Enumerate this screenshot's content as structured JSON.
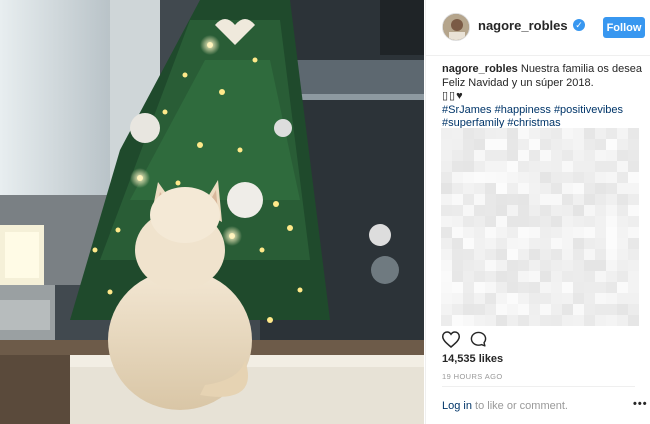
{
  "post": {
    "username": "nagore_robles",
    "follow_label": "Follow",
    "caption_line1": "Nuestra familia os desea",
    "caption_line2": "Feliz Navidad y un súper 2018.",
    "caption_emoji": "▯▯♥",
    "hashtags": [
      "#SrJames",
      "#happiness",
      "#positivevibes",
      "#superfamily",
      "#christmas"
    ],
    "likes": "14,535 likes",
    "time": "19 HOURS AGO",
    "login_link": "Log in",
    "login_rest": " to like or comment.",
    "more": "•••"
  },
  "colors": {
    "accent": "#3897f0",
    "hashtag": "#003569",
    "muted": "#999999"
  },
  "icons": {
    "verified": "verified-badge-icon",
    "like": "heart-outline-icon",
    "comment": "speech-bubble-icon",
    "more": "more-options-icon"
  }
}
